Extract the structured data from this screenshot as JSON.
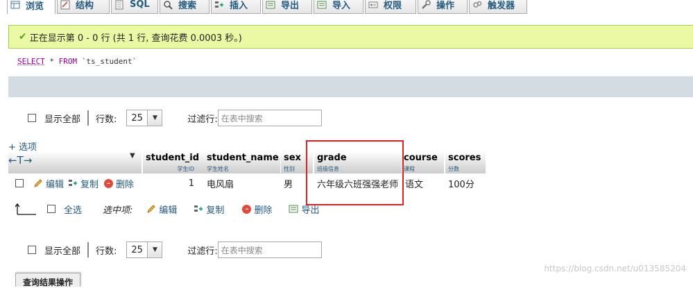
{
  "tabs": [
    {
      "label": "浏览",
      "icon": "browse-icon",
      "active": true
    },
    {
      "label": "结构",
      "icon": "structure-icon"
    },
    {
      "label": "SQL",
      "icon": "sql-icon"
    },
    {
      "label": "搜索",
      "icon": "search-icon"
    },
    {
      "label": "插入",
      "icon": "insert-icon"
    },
    {
      "label": "导出",
      "icon": "export-icon"
    },
    {
      "label": "导入",
      "icon": "import-icon"
    },
    {
      "label": "权限",
      "icon": "privileges-icon"
    },
    {
      "label": "操作",
      "icon": "wrench-icon"
    },
    {
      "label": "触发器",
      "icon": "triggers-icon"
    }
  ],
  "success_message": "正在显示第 0 - 0 行 (共 1 行, 查询花费 0.0003 秒。)",
  "sql": {
    "select": "SELECT",
    "rest": " * ",
    "from": "FROM",
    "table": " `ts_student`"
  },
  "nav": {
    "show_all": "显示全部",
    "rows_label": "行数:",
    "rows_value": "25",
    "filter_label": "过滤行:",
    "filter_placeholder": "在表中搜索"
  },
  "options_link": "+ 选项",
  "columns": [
    {
      "name": "student_id",
      "comment": "学生ID"
    },
    {
      "name": "student_name",
      "comment": "学生姓名"
    },
    {
      "name": "sex",
      "comment": "性别"
    },
    {
      "name": "grade",
      "comment": "班级信息"
    },
    {
      "name": "course",
      "comment": "课程"
    },
    {
      "name": "scores",
      "comment": "分数"
    }
  ],
  "row_actions": {
    "edit": "编辑",
    "copy": "复制",
    "delete": "删除"
  },
  "rows": [
    {
      "student_id": "1",
      "student_name": "电风扇",
      "sex": "男",
      "grade": "六年级六班强强老师",
      "course": "语文",
      "scores": "100分"
    }
  ],
  "bulk": {
    "check_all": "全选",
    "with_selected": "选中项:",
    "edit": "编辑",
    "copy": "复制",
    "delete": "删除",
    "export": "导出"
  },
  "footer_tab": "查询结果操作",
  "watermark": "https://blog.csdn.net/u013585204",
  "colors": {
    "success_bg": "#ebf8a4",
    "link": "#235a81",
    "highlight": "#e02020"
  }
}
